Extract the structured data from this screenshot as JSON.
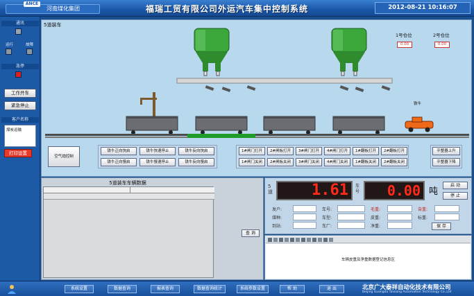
{
  "header": {
    "logo": "ANCE",
    "group_name": "河南煤化集团",
    "title": "福瑞工贸有限公司外运汽车集中控制系统",
    "datetime": "2012-08-21 10:16:07"
  },
  "sidebar": {
    "section_power": "通讯",
    "label_run": "运行",
    "label_fault": "故障",
    "section_alarm": "急停",
    "btn_start": "工作开车",
    "btn_stop": "紧急停止",
    "section_client": "客户名称",
    "client_name": "煤炭运输",
    "btn_print": "打印设置"
  },
  "scene": {
    "label": "5道装车",
    "silo1_label": "1号仓位",
    "silo1_value": "0.00",
    "silo2_label": "2号仓位",
    "silo2_value": "0.00",
    "tractor_label": "铁牛"
  },
  "controls": {
    "air_btn": "空气炮控制",
    "row1": [
      "铁牛正向快启",
      "铁牛快速停止",
      "铁牛反向快启"
    ],
    "row2": [
      "铁牛正向慢启",
      "铁牛慢速停止",
      "铁牛反向慢启"
    ],
    "gate_row1": [
      "1#闸门打开",
      "2#闸板打开",
      "3#闸门打开",
      "4#闸门打开",
      "1#翻板打开",
      "2#翻板打开"
    ],
    "gate_row2": [
      "1#闸门关闭",
      "2#闸板关闭",
      "3#闸门关闭",
      "4#闸门关闭",
      "1#翻板关闭",
      "2#翻板关闭"
    ],
    "platform_up": "平整器上升",
    "platform_down": "平整器下降"
  },
  "data_table": {
    "title": "5道装车车辆数据",
    "query_btn": "查 询"
  },
  "weighing": {
    "channel_label": "5道",
    "weight": "1.61",
    "car_label": "车号",
    "net_weight": "0.00",
    "unit": "吨",
    "btn_start": "启 动",
    "btn_stop": "停 止",
    "fields_col1": [
      "发户:",
      "煤种:",
      "到站:"
    ],
    "fields_col2": [
      "车号:",
      "车型:",
      "车厂:"
    ],
    "fields_col3": [
      "毛重:",
      "皮重:",
      "净重:"
    ],
    "fields_col4": [
      "自重:",
      "标重:"
    ],
    "btn_save": "保 存"
  },
  "editor": {
    "text": "车辆皮重及净重数据登记信息区"
  },
  "footer": {
    "buttons": [
      "系统设置",
      "数据查询",
      "报表查询",
      "数据查询统计",
      "系统参数设置",
      "帮 助",
      "退 出"
    ],
    "company": "北京广大泰祥自动化技术有限公司",
    "company_en": "Beijing Guangda Taixiang Automation Technology Co.,Ltd"
  }
}
